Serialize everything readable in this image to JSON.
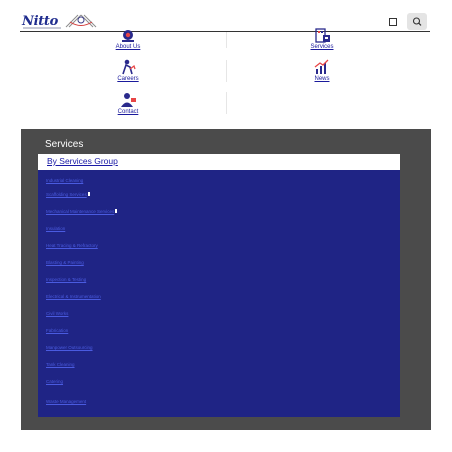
{
  "header": {
    "logo_text": "Nitto"
  },
  "tiles": [
    {
      "label": "About Us",
      "icon": "about-us-icon"
    },
    {
      "label": "Services",
      "icon": "services-icon"
    },
    {
      "label": "Careers",
      "icon": "careers-icon"
    },
    {
      "label": "News",
      "icon": "news-icon"
    },
    {
      "label": "Contact",
      "icon": "contact-icon"
    }
  ],
  "services": {
    "title": "Services",
    "group_link": "By Services Group",
    "items": [
      "Industrial Cleaning",
      "Scaffolding Services",
      "Mechanical Maintenance Services",
      "Insulation",
      "Heat Tracing & Refractory",
      "Blasting & Painting",
      "Inspection & Testing",
      "Electrical & Instrumentation",
      "Civil Works",
      "Fabrication",
      "Manpower Outsourcing",
      "Tank Cleaning",
      "Catering",
      "Waste Management"
    ]
  },
  "colors": {
    "panel": "#4b4b4b",
    "list_bg": "#1f2485",
    "link": "#1a1a9c"
  }
}
